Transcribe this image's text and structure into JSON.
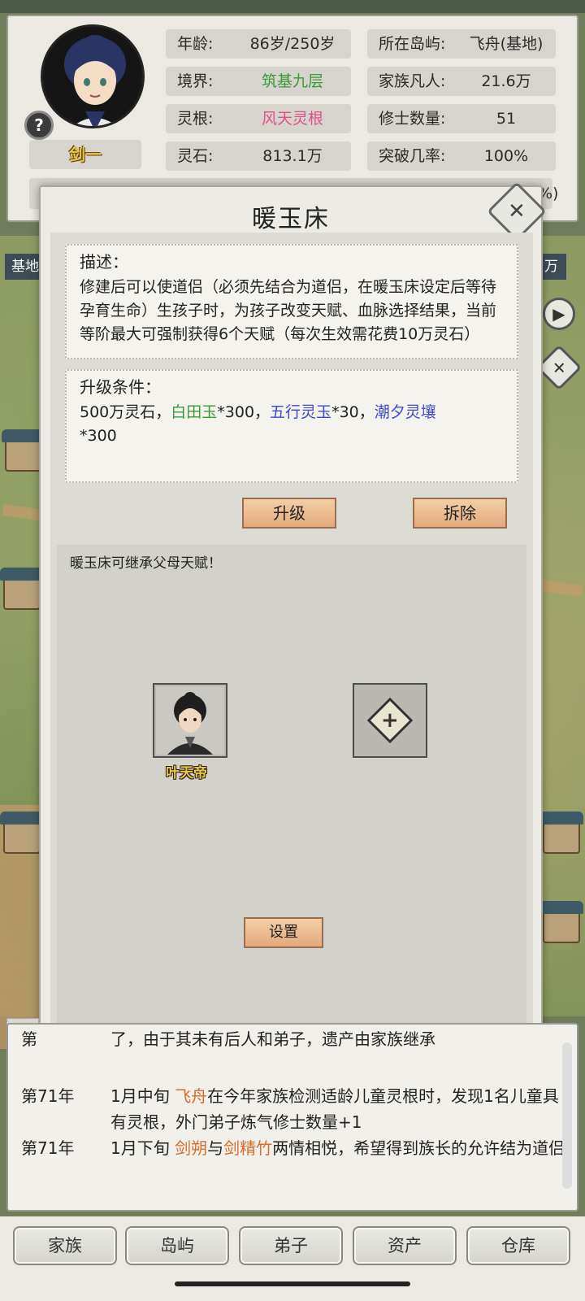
{
  "player": {
    "name": "剑一",
    "stats_left": [
      {
        "label": "年龄:",
        "value": "86岁/250岁"
      },
      {
        "label": "境界:",
        "value": "筑基九层"
      },
      {
        "label": "灵根:",
        "value": "风天灵根"
      },
      {
        "label": "灵石:",
        "value": "813.1万"
      }
    ],
    "stats_right": [
      {
        "label": "所在岛屿:",
        "value": "飞舟(基地)"
      },
      {
        "label": "家族凡人:",
        "value": "21.6万"
      },
      {
        "label": "修士数量:",
        "value": "51"
      },
      {
        "label": "突破几率:",
        "value": "100%"
      }
    ],
    "peek_percent": "%)",
    "help_icon": "?"
  },
  "side": {
    "left_label": "基地",
    "right_label": "万"
  },
  "modal": {
    "title": "暖玉床",
    "close_icon": "✕",
    "description_head": "描述：",
    "description": "修建后可以使道侣（必须先结合为道侣，在暖玉床设定后等待孕育生命）生孩子时，为孩子改变天赋、血脉选择结果，当前等阶最大可强制获得6个天赋（每次生效需花费10万灵石）",
    "upgrade_head": "升级条件：",
    "upgrade_req": {
      "a": "500万灵石，",
      "b": "白田玉",
      "c": "*300，",
      "d": "五行灵玉",
      "e": "*30，",
      "f": "潮夕灵壤",
      "g": "*300"
    },
    "upgrade_btn": "升级",
    "demolish_btn": "拆除",
    "tip": "暖玉床可继承父母天赋！",
    "char_name": "叶天帝",
    "add_icon": "+",
    "set_btn": "设置"
  },
  "log": {
    "tab": "家",
    "top_partial_year": "第",
    "top_partial_text": "了，由于其未有后人和弟子，遗产由家族继承",
    "entries": [
      {
        "year": "第71年",
        "pre": "1月中旬 ",
        "hl1": "飞舟",
        "mid": "在今年家族检测适龄儿童灵根时，发现1名儿童具有灵根，外门弟子炼气修士数量+1",
        "hl2": "",
        "post": ""
      },
      {
        "year": "第71年",
        "pre": "1月下旬 ",
        "hl1": "剑朔",
        "mid": "与",
        "hl2": "剑精竹",
        "post": "两情相悦，希望得到族长的允许结为道侣"
      }
    ]
  },
  "nav": [
    "家族",
    "岛屿",
    "弟子",
    "资产",
    "仓库"
  ],
  "colors": {
    "green": "#3a9a3a",
    "pink": "#e0508a",
    "blue": "#3a4ad0",
    "orange": "#d86c2c",
    "gold_name": "#e6c84a"
  }
}
